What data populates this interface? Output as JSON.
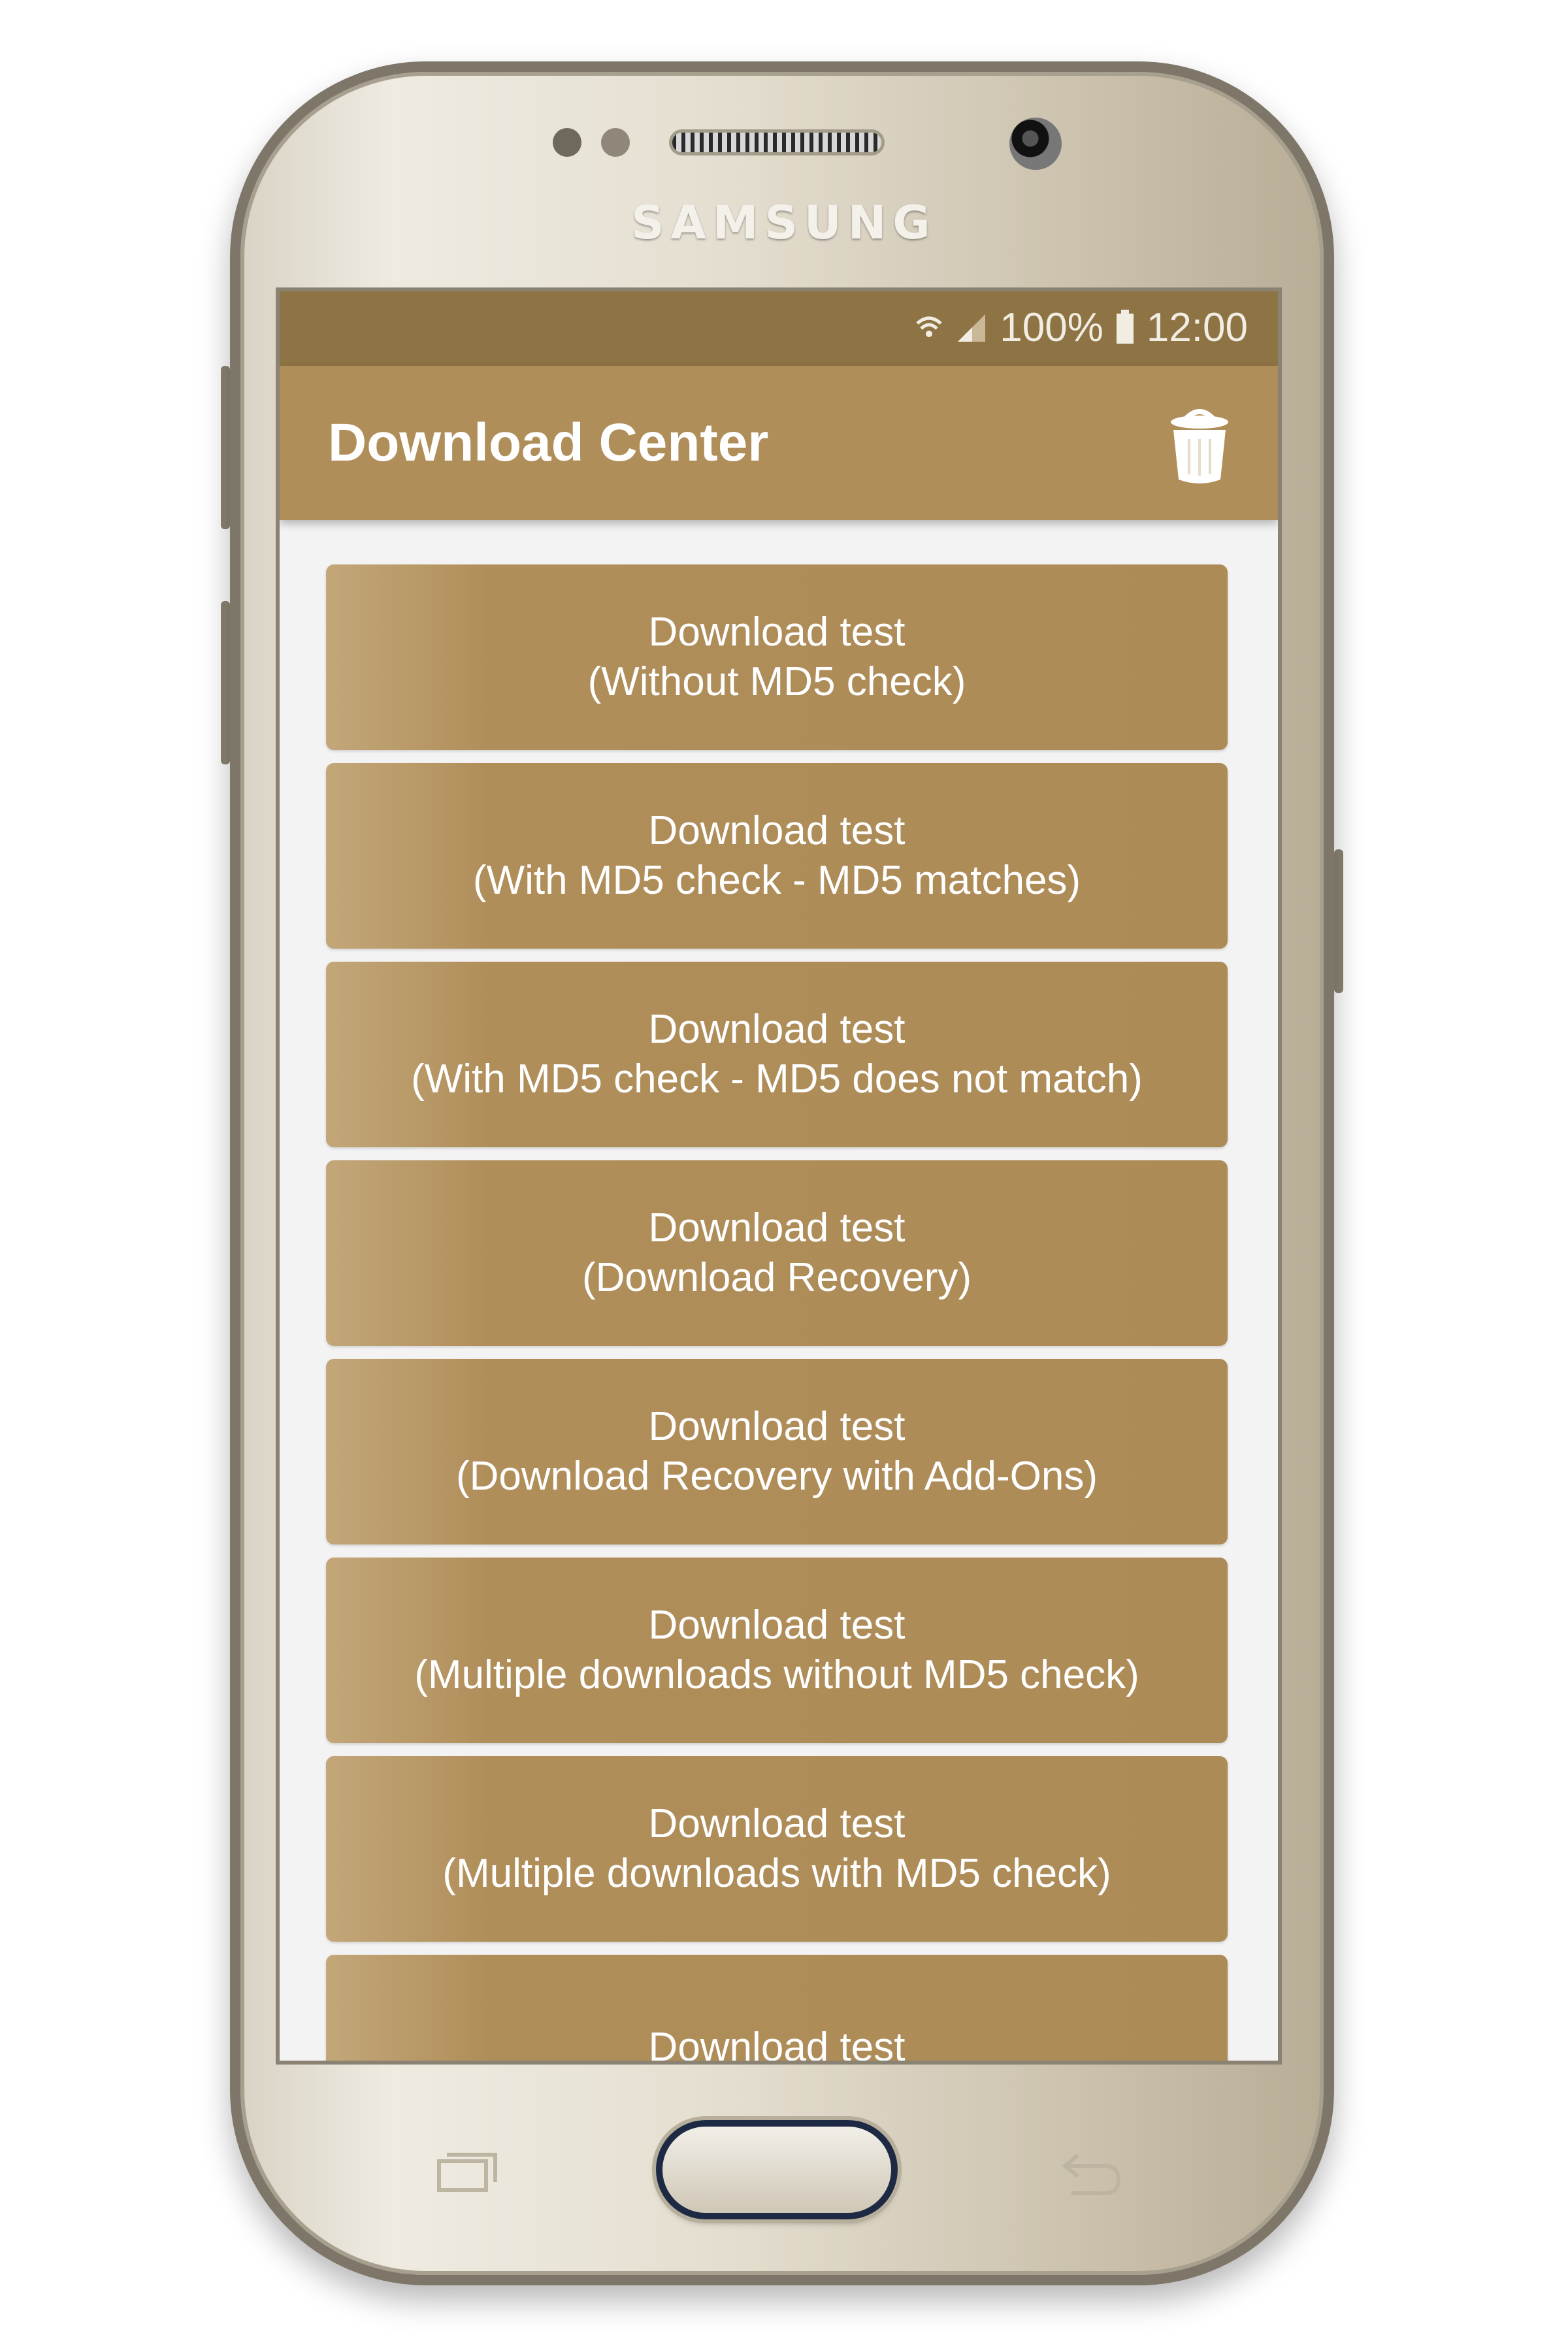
{
  "device": {
    "brand": "SAMSUNG"
  },
  "status_bar": {
    "battery": "100%",
    "time": "12:00",
    "icons": [
      "wifi-icon",
      "signal-icon",
      "battery-icon"
    ]
  },
  "app_bar": {
    "title": "Download Center",
    "action_icon": "trash-icon"
  },
  "buttons": [
    {
      "line1": "Download test",
      "line2": "(Without MD5 check)"
    },
    {
      "line1": "Download test",
      "line2": "(With MD5 check - MD5 matches)"
    },
    {
      "line1": "Download test",
      "line2": "(With MD5 check - MD5 does not match)"
    },
    {
      "line1": "Download test",
      "line2": "(Download Recovery)"
    },
    {
      "line1": "Download test",
      "line2": "(Download Recovery with Add-Ons)"
    },
    {
      "line1": "Download test",
      "line2": "(Multiple downloads without MD5 check)"
    },
    {
      "line1": "Download test",
      "line2": "(Multiple downloads with MD5 check)"
    },
    {
      "line1": "Download test",
      "line2": ""
    }
  ],
  "colors": {
    "accent": "#b08e5a",
    "status_bar": "#8e7345",
    "background": "#f3f3f3"
  },
  "nav_icons": [
    "recent-apps-icon",
    "home-button",
    "back-icon"
  ]
}
